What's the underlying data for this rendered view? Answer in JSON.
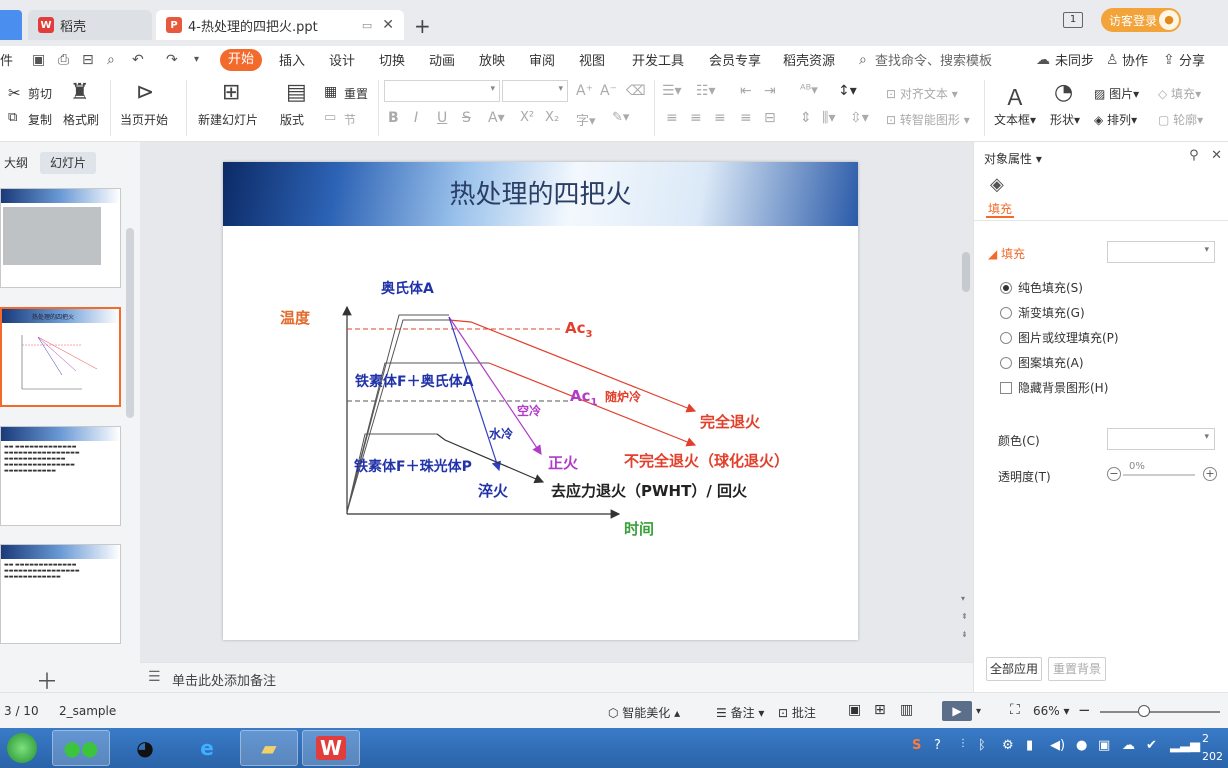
{
  "tabs": [
    {
      "label": "稻壳",
      "icon": "daoke-logo-icon"
    },
    {
      "label": "4-热处理的四把火.ppt",
      "icon": "ppt-file-icon"
    }
  ],
  "titlebar": {
    "window_count": "1",
    "login_label": "访客登录"
  },
  "menu": {
    "file": "件",
    "start": "开始",
    "items": [
      "插入",
      "设计",
      "切换",
      "动画",
      "放映",
      "审阅",
      "视图",
      "开发工具",
      "会员专享",
      "稻壳资源"
    ],
    "search": "查找命令、搜索模板",
    "sync": "未同步",
    "collab": "协作",
    "share": "分享"
  },
  "ribbon": {
    "cut": "剪切",
    "copy": "复制",
    "format_painter": "格式刷",
    "from_current": "当页开始",
    "new_slide": "新建幻灯片",
    "layout": "版式",
    "reset": "重置",
    "section": "节",
    "align_text": "对齐文本",
    "smart_art": "转智能图形",
    "textbox": "文本框",
    "shape": "形状",
    "picture": "图片",
    "arrange": "排列",
    "fill": "填充",
    "outline": "轮廓"
  },
  "left_panel": {
    "outline_tab": "大纲",
    "slides_tab": "幻灯片",
    "thumb2_title": "热处理的四把火"
  },
  "slide": {
    "title": "热处理的四把火",
    "labels": {
      "austenite": "奥氏体A",
      "temperature": "温度",
      "ac3": "Ac",
      "ac3_sub": "3",
      "ferrite_austenite": "铁素体F＋奥氏体A",
      "ac1": "Ac",
      "ac1_sub": "1",
      "furnace_cool": "随炉冷",
      "air_cool": "空冷",
      "water_cool": "水冷",
      "full_anneal": "完全退火",
      "normalize": "正火",
      "incomplete_anneal": "不完全退火（球化退火）",
      "ferrite_pearlite": "铁素体F＋珠光体P",
      "quench": "淬火",
      "stress_relief": "去应力退火（PWHT）/ 回火",
      "time": "时间"
    }
  },
  "notes": {
    "placeholder": "单击此处添加备注"
  },
  "right_panel": {
    "title": "对象属性",
    "fill_tab": "填充",
    "fill_section": "填充",
    "options": [
      "纯色填充(S)",
      "渐变填充(G)",
      "图片或纹理填充(P)",
      "图案填充(A)"
    ],
    "hide_bg": "隐藏背景图形(H)",
    "color_label": "颜色(C)",
    "transparency_label": "透明度(T)",
    "transparency_value": "0%",
    "apply_all": "全部应用",
    "reset_bg": "重置背景"
  },
  "status": {
    "page": "3 / 10",
    "theme": "2_sample",
    "beautify": "智能美化",
    "notes": "备注",
    "comment": "批注",
    "zoom": "66%"
  },
  "clock": {
    "line1": "2",
    "line2": "202"
  },
  "colors": {
    "accent": "#f26b2c",
    "blue_text": "#2233aa",
    "red_text": "#e2402c",
    "purple": "#b03cc8"
  }
}
